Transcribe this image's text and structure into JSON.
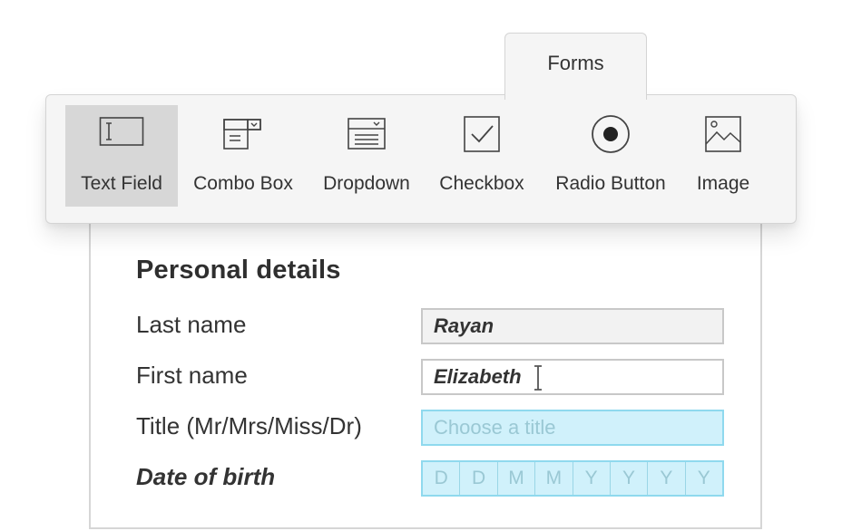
{
  "toolbar": {
    "tab_label": "Forms",
    "tools": [
      {
        "label": "Text Field",
        "icon": "text-field-icon",
        "active": true
      },
      {
        "label": "Combo Box",
        "icon": "combo-box-icon"
      },
      {
        "label": "Dropdown",
        "icon": "dropdown-icon"
      },
      {
        "label": "Checkbox",
        "icon": "checkbox-icon"
      },
      {
        "label": "Radio Button",
        "icon": "radio-button-icon"
      },
      {
        "label": "Image",
        "icon": "image-icon"
      }
    ]
  },
  "form": {
    "section_title": "Personal details",
    "last_name": {
      "label": "Last name",
      "value": "Rayan"
    },
    "first_name": {
      "label": "First name",
      "value": "Elizabeth"
    },
    "title": {
      "label": "Title (Mr/Mrs/Miss/Dr)",
      "placeholder": "Choose a title"
    },
    "dob": {
      "label": "Date of birth",
      "cells": [
        "D",
        "D",
        "M",
        "M",
        "Y",
        "Y",
        "Y",
        "Y"
      ]
    }
  },
  "colors": {
    "toolbar_bg": "#f5f5f5",
    "active_tool_bg": "#d7d7d7",
    "highlight_field": "#d0f1fb",
    "highlight_border": "#8fd9ee"
  }
}
